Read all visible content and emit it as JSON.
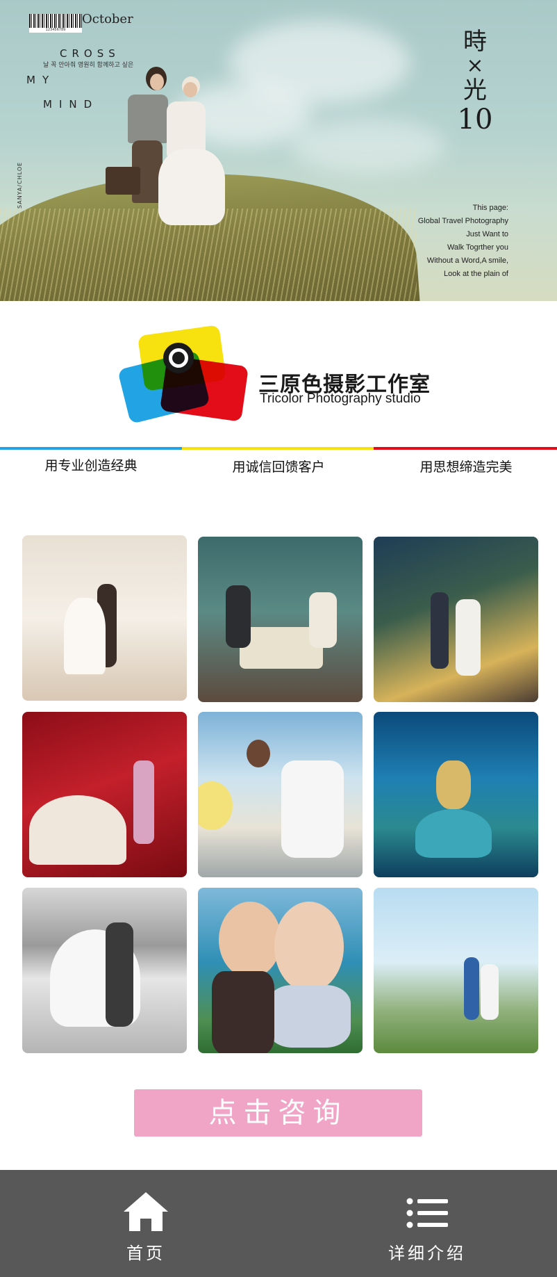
{
  "hero": {
    "barcode_number": "123456789",
    "month": "October",
    "cross": "CROSS",
    "my": "MY",
    "mind": "MIND",
    "script_line": "날 꼭 안아줘 영원히 함께하고 싶은",
    "side_text": "SANYA/CHLOE",
    "jp_title_1": "時",
    "jp_title_2": "×",
    "jp_title_3": "光",
    "jp_title_4": "10",
    "tagline": [
      "This page:",
      "Global Travel Photography",
      "Just Want to",
      "Walk Togrther you",
      "Without a Word,A smile,",
      "Look at the plain of"
    ]
  },
  "brand": {
    "name": "三原色摄影工作室",
    "subtitle": "Tricolor Photography studio",
    "colors": {
      "yellow": "#f7e10e",
      "blue": "#22a4e4",
      "red": "#e30d1a"
    }
  },
  "slogans": [
    "用专业创造经典",
    "用诚信回馈客户",
    "用思想缔造完美"
  ],
  "gallery": {
    "photos": [
      "wedding-photo-palace-window",
      "wedding-photo-vintage-table",
      "wedding-photo-night-street",
      "wedding-photo-red-roses",
      "wedding-photo-balloon-building",
      "wedding-photo-underwater-mermaid",
      "wedding-photo-beach-bw",
      "wedding-photo-seaside-closeup",
      "wedding-photo-grass-field"
    ]
  },
  "cta": {
    "label": "点击咨询",
    "color": "#f0a5c7"
  },
  "bottom_nav": {
    "home_label": "首页",
    "detail_label": "详细介绍",
    "home_icon": "home-icon",
    "detail_icon": "list-icon"
  }
}
